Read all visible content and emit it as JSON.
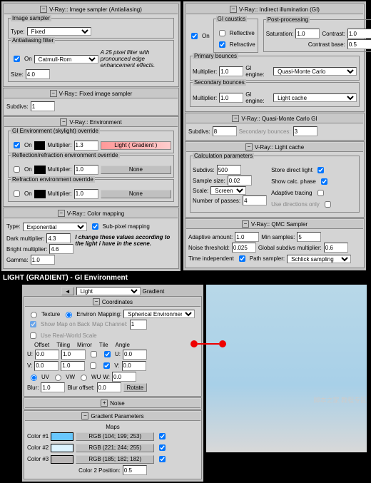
{
  "img_sampler": {
    "title": "V-Ray:: Image sampler (Antialiasing)",
    "grp1": "Image sampler",
    "typeLbl": "Type:",
    "type": "Fixed",
    "grp2": "Antialiasing filter",
    "onLbl": "On",
    "filter": "Catmull-Rom",
    "note": "A 25 pixel filter with pronounced edge enhancement effects.",
    "sizeLbl": "Size:",
    "size": "4.0"
  },
  "fixed": {
    "title": "V-Ray:: Fixed image sampler",
    "subLbl": "Subdivs:",
    "sub": "1"
  },
  "env": {
    "title": "V-Ray:: Environment",
    "grp1": "GI Environment (skylight) override",
    "onLbl": "On",
    "multLbl": "Multiplier:",
    "mult": "1.3",
    "mapBtn": "Light   ( Gradient )",
    "grp2": "Reflection/refraction environment override",
    "darkMult": "1.0",
    "none": "None",
    "grp3": "Refraction environment override",
    "rMult": "1.0"
  },
  "cmap": {
    "title": "V-Ray:: Color mapping",
    "typeLbl": "Type:",
    "type": "Exponential",
    "subpx": "Sub-pixel mapping",
    "darkLbl": "Dark multiplier:",
    "dark": "4.3",
    "brightLbl": "Bright multiplier:",
    "bright": "4.6",
    "gammaLbl": "Gamma:",
    "gamma": "1.0",
    "note": "I change these values according to the light i have in the scene."
  },
  "gi": {
    "title": "V-Ray:: Indirect illumination (GI)",
    "onLbl": "On",
    "grp1": "GI caustics",
    "refl": "Reflective",
    "refr": "Refractive",
    "grp2": "Post-processing",
    "satLbl": "Saturation:",
    "sat": "1.0",
    "conLbl": "Contrast:",
    "con": "1.0",
    "cbLbl": "Contrast base:",
    "cb": "0.5",
    "grp3": "Primary bounces",
    "multLbl": "Multiplier:",
    "mult1": "1.0",
    "engLbl": "GI engine:",
    "eng1": "Quasi-Monte Carlo",
    "grp4": "Secondary bounces",
    "mult2": "1.0",
    "eng2": "Light cache"
  },
  "qmc": {
    "title": "V-Ray:: Quasi-Monte Carlo GI",
    "subLbl": "Subdivs:",
    "sub": "8",
    "secLbl": "Secondary bounces:",
    "sec": "3"
  },
  "lc": {
    "title": "V-Ray:: Light cache",
    "grp": "Calculation parameters",
    "subLbl": "Subdivs:",
    "sub": "500",
    "sampLbl": "Sample size:",
    "samp": "0.02",
    "scaleLbl": "Scale:",
    "scale": "Screen",
    "passLbl": "Number of passes:",
    "pass": "4",
    "storeLbl": "Store direct light",
    "showLbl": "Show calc. phase",
    "adaptLbl": "Adaptive tracing",
    "dirLbl": "Use directions only"
  },
  "qmcs": {
    "title": "V-Ray:: QMC Sampler",
    "adaptLbl": "Adaptive amount:",
    "adapt": "1.0",
    "minLbl": "Min samples:",
    "min": "5",
    "noiseLbl": "Noise threshold:",
    "noise": "0.025",
    "globLbl": "Global subdivs multiplier:",
    "glob": "0.6",
    "timeLbl": "Time independent",
    "pathLbl": "Path sampler:",
    "path": "Schlick sampling"
  },
  "section": "LIGHT (GRADIENT) - GI Environment",
  "mat": {
    "slot": "Light",
    "type": "Gradient",
    "coord": "Coordinates",
    "texture": "Texture",
    "environ": "Environ",
    "mapping": "Mapping:",
    "mapVal": "Spherical Environment",
    "showMap": "Show Map on Back",
    "mapCh": "Map Channel:",
    "mapChV": "1",
    "realWorld": "Use Real-World Scale",
    "offset": "Offset",
    "tiling": "Tiling",
    "mirror": "Mirror",
    "tile": "Tile",
    "angle": "Angle",
    "u": "U:",
    "v": "V:",
    "w": "W:",
    "uv": "UV",
    "vw": "VW",
    "wu": "WU",
    "u0": "0.0",
    "t1": "1.0",
    "a0": "0.0",
    "blurLbl": "Blur:",
    "blur": "1.0",
    "boLbl": "Blur offset:",
    "bo": "0.0",
    "rotate": "Rotate",
    "noise": "Noise",
    "gparam": "Gradient Parameters",
    "maps": "Maps",
    "c1": "Color #1",
    "c2": "Color #2",
    "c3": "Color #3",
    "rgb1": "RGB (104; 199; 253)",
    "rgb2": "RGB (221; 244; 255)",
    "rgb3": "RGB (185; 182; 182)",
    "c2pLbl": "Color 2 Position:",
    "c2p": "0.5"
  },
  "wm": "脚本之家 教程专区"
}
